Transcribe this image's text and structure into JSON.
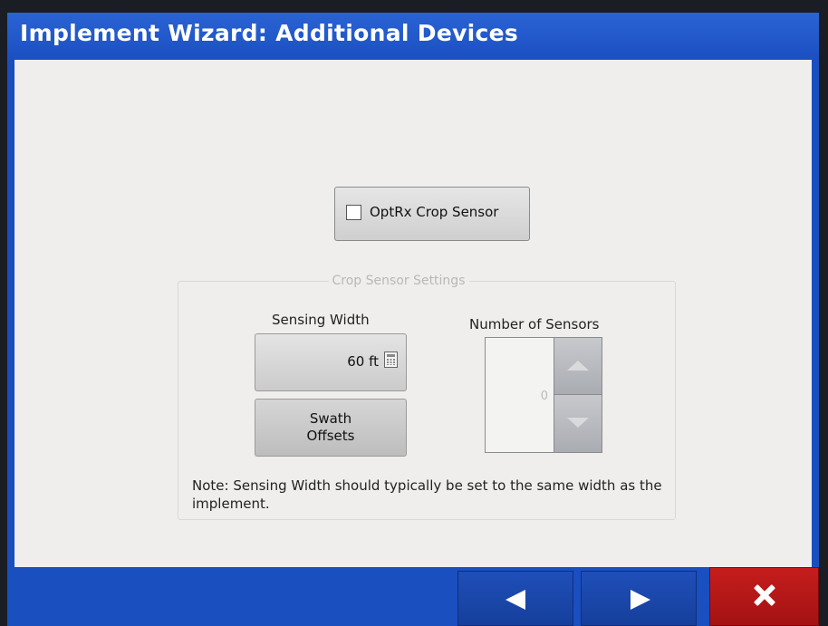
{
  "window": {
    "title": "Implement Wizard:  Additional Devices"
  },
  "optrx": {
    "label": "OptRx Crop Sensor",
    "checked": false
  },
  "crop_sensor_settings": {
    "group_label": "Crop Sensor Settings",
    "sensing_width": {
      "label": "Sensing Width",
      "value": "60 ft",
      "icon": "calculator-icon"
    },
    "swath_offsets": {
      "label_line1": "Swath",
      "label_line2": "Offsets"
    },
    "number_of_sensors": {
      "label": "Number of Sensors",
      "value": "0",
      "up_icon": "triangle-up-icon",
      "down_icon": "triangle-down-icon"
    },
    "note": "Note: Sensing Width should typically be set to the same width as the implement."
  },
  "footer": {
    "back_icon": "arrow-left-icon",
    "next_icon": "arrow-right-icon",
    "cancel_icon": "close-icon"
  },
  "colors": {
    "title_bar": "#1b4fc2",
    "content_bg": "#efeeec",
    "nav_button": "#1a4ab0",
    "cancel_button": "#b51818"
  }
}
